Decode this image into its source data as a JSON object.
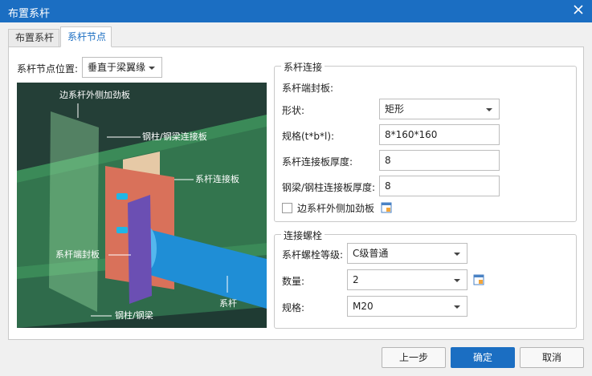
{
  "window": {
    "title": "布置系杆"
  },
  "tabs": [
    {
      "label": "布置系杆"
    },
    {
      "label": "系杆节点"
    }
  ],
  "node_position": {
    "label": "系杆节点位置:",
    "value": "垂直于梁翼缘"
  },
  "scene": {
    "labels": {
      "outer_stiffener": "边系杆外侧加劲板",
      "steel_connect_plate": "钢柱/钢梁连接板",
      "tie_connect_plate": "系杆连接板",
      "end_plate": "系杆端封板",
      "tie_rod": "系杆",
      "steel_member": "钢柱/钢梁"
    }
  },
  "connection": {
    "legend": "系杆连接",
    "end_plate_heading": "系杆端封板:",
    "shape_label": "形状:",
    "shape_value": "矩形",
    "spec_label": "规格(t*b*l):",
    "spec_value": "8*160*160",
    "tie_plate_thickness_label": "系杆连接板厚度:",
    "tie_plate_thickness_value": "8",
    "steel_plate_thickness_label": "钢梁/钢柱连接板厚度:",
    "steel_plate_thickness_value": "8",
    "outer_stiffener_label": "边系杆外侧加劲板"
  },
  "bolts": {
    "legend": "连接螺栓",
    "grade_label": "系杆螺栓等级:",
    "grade_value": "C级普通",
    "count_label": "数量:",
    "count_value": "2",
    "spec_label": "规格:",
    "spec_value": "M20"
  },
  "buttons": {
    "prev": "上一步",
    "ok": "确定",
    "cancel": "取消"
  },
  "colors": {
    "title_bar": "#1b6ec2",
    "accent": "#1b6ec2"
  }
}
